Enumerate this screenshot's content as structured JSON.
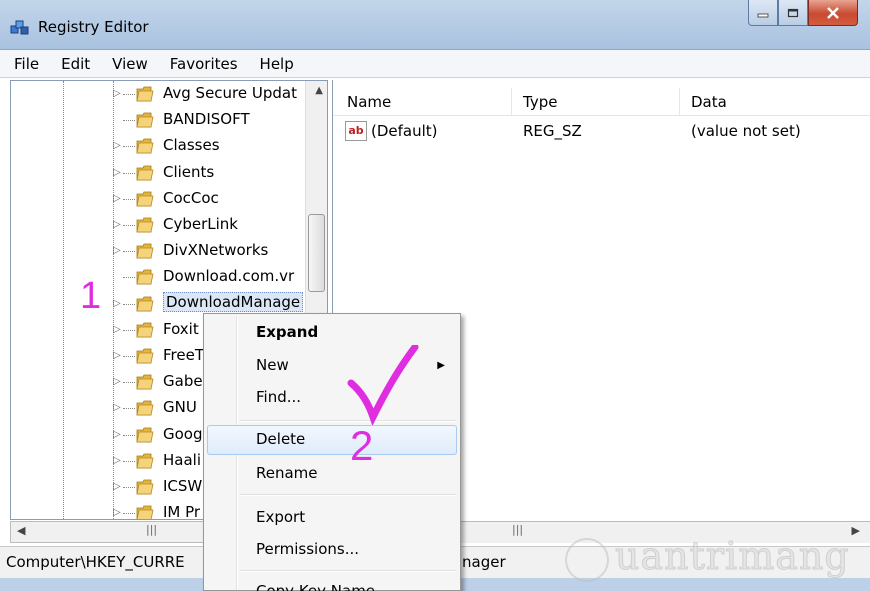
{
  "window": {
    "title": "Registry Editor"
  },
  "menu": [
    "File",
    "Edit",
    "View",
    "Favorites",
    "Help"
  ],
  "tree": {
    "items": [
      {
        "label": "Avg Secure Updat",
        "expandable": true
      },
      {
        "label": "BANDISOFT",
        "expandable": false
      },
      {
        "label": "Classes",
        "expandable": true
      },
      {
        "label": "Clients",
        "expandable": true
      },
      {
        "label": "CocCoc",
        "expandable": true
      },
      {
        "label": "CyberLink",
        "expandable": true
      },
      {
        "label": "DivXNetworks",
        "expandable": true
      },
      {
        "label": "Download.com.vr",
        "expandable": false
      },
      {
        "label": "DownloadManage",
        "expandable": true,
        "selected": true
      },
      {
        "label": "Foxit",
        "expandable": true
      },
      {
        "label": "FreeT",
        "expandable": true
      },
      {
        "label": "Gabe",
        "expandable": true
      },
      {
        "label": "GNU",
        "expandable": true
      },
      {
        "label": "Goog",
        "expandable": true
      },
      {
        "label": "Haali",
        "expandable": true
      },
      {
        "label": "ICSW",
        "expandable": true
      },
      {
        "label": "IM Pr",
        "expandable": true
      }
    ]
  },
  "list": {
    "columns": [
      "Name",
      "Type",
      "Data"
    ],
    "rows": [
      {
        "name": "(Default)",
        "type": "REG_SZ",
        "data": "(value not set)",
        "icon": "ab"
      }
    ]
  },
  "context_menu": {
    "items": [
      {
        "label": "Expand",
        "bold": true
      },
      {
        "label": "New",
        "submenu": true
      },
      {
        "label": "Find..."
      },
      {
        "label": "Delete",
        "hover": true
      },
      {
        "label": "Rename"
      },
      {
        "label": "Export"
      },
      {
        "label": "Permissions..."
      },
      {
        "label": "Copy Key Name"
      }
    ]
  },
  "status": {
    "path": "Computer\\HKEY_CURRE",
    "tail": "nager"
  },
  "annotations": {
    "step1": "1",
    "step2": "2"
  },
  "watermark": {
    "text": "uantrimang"
  },
  "colors": {
    "annotation": "#e02de0",
    "titlebar": "#b7cde6",
    "close_button": "#c94a32"
  }
}
